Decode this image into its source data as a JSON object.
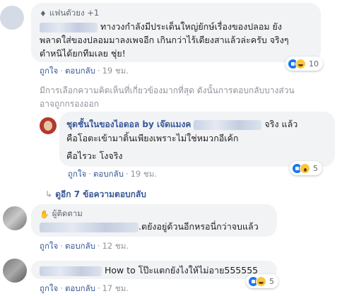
{
  "comment1": {
    "badge": "แฟนตัวยง +1",
    "text_line1": "ทางวงกำลังมีประเด็นใหญ่ยักษ์เรื่องของปลอม ยัง",
    "text_line2": "พลาดใส่ของปลอมมาลงเพจอีก เกินกว่าไร้เดียงสาแล้วล่ะครับ จริงๆ",
    "text_line3": "ตำหนิได้ยกทีมเลย ชุ่ย!",
    "like": "ถูกใจ",
    "reply": "ตอบกลับ",
    "time": "19 ชม.",
    "reaction_count": "10"
  },
  "filter_notice": {
    "line1": "มีการเลือกความคิดเห็นที่เกี่ยวข้องมากที่สุด ดังนั้นการตอบกลับบางส่วน",
    "line2": "อาจถูกกรองออก"
  },
  "reply1": {
    "name": "ชุดชั้นในของไอดอล by เจ๊ดแมงค",
    "text_line1_tail": "จริง แล้ว",
    "text_line2": "คือโอตะเข้ามาติ้นเพียงเพราะไม่ใช่หมวกอีเค้ก",
    "text_line3": "คือไรวะ โงจริง",
    "like": "ถูกใจ",
    "reply": "ตอบกลับ",
    "time": "19 ชม.",
    "reaction_count": "5"
  },
  "view_replies": "ดูอีก 7 ข้อความตอบกลับ",
  "comment2": {
    "badge": "ผู้ติดตาม",
    "text_tail": ".ตยังอยู่ด้วนอีกหรอนี่กว่าจบแล้ว",
    "like": "ถูกใจ",
    "reply": "ตอบกลับ",
    "time": "12 ชม."
  },
  "comment3": {
    "text_tail": "How to โป๊ะแตกยังไงให้ไม่อาย555555",
    "like": "ถูกใจ",
    "reply": "ตอบกลับ",
    "time": "17 ชม.",
    "reaction_count": "5"
  },
  "colors": {
    "link": "#385898",
    "bubble": "#f2f3f5",
    "like_blue": "#1877f2",
    "emoji_yellow": "#f7c83c"
  },
  "icons": {
    "fan_badge": "diamond-icon",
    "follower_badge": "wave-hand-icon",
    "view_more": "reply-arrow-icon"
  }
}
